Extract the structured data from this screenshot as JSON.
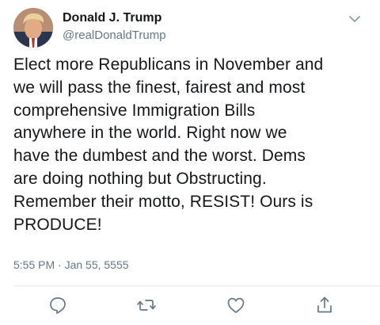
{
  "author": {
    "display_name": "Donald J. Trump",
    "handle": "@realDonaldTrump",
    "avatar_icon": "profile-photo"
  },
  "tweet": {
    "text": "Elect more Republicans in November and\nwe will pass the finest, fairest and most\ncomprehensive Immigration Bills\nanywhere in the world. Right now we\nhave the dumbest and the worst. Dems\nare doing nothing but Obstructing.\nRemember their motto, RESIST! Ours is\nPRODUCE!",
    "timestamp": "5:55 PM · Jan 55, 5555"
  },
  "actions": {
    "reply_icon": "speech-bubble-icon",
    "retweet_icon": "retweet-arrows-icon",
    "like_icon": "heart-icon",
    "share_icon": "share-upload-icon",
    "more_icon": "chevron-down-icon"
  },
  "colors": {
    "text": "#14171a",
    "secondary": "#657786",
    "divider": "#e6ecf0"
  }
}
